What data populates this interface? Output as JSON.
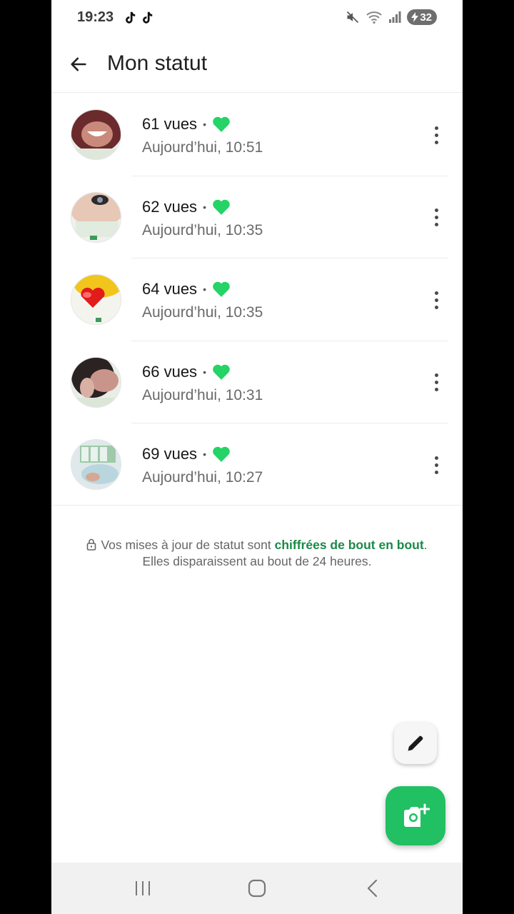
{
  "status_bar": {
    "time": "19:23",
    "battery": "32",
    "icons": [
      "tiktok-icon",
      "tiktok-icon",
      "mute-icon",
      "wifi-icon",
      "signal-icon",
      "battery-charging-icon"
    ]
  },
  "header": {
    "title": "Mon statut",
    "back_icon": "arrow-left-icon"
  },
  "statuses": [
    {
      "views": "61 vues",
      "time": "Aujourd’hui, 10:51",
      "heart_icon": "green-heart-icon"
    },
    {
      "views": "62 vues",
      "time": "Aujourd’hui, 10:35",
      "heart_icon": "green-heart-icon"
    },
    {
      "views": "64 vues",
      "time": "Aujourd’hui, 10:35",
      "heart_icon": "green-heart-icon"
    },
    {
      "views": "66 vues",
      "time": "Aujourd’hui, 10:31",
      "heart_icon": "green-heart-icon"
    },
    {
      "views": "69 vues",
      "time": "Aujourd’hui, 10:27",
      "heart_icon": "green-heart-icon"
    }
  ],
  "notice": {
    "prefix": "Vos mises à jour de statut sont ",
    "link": "chiffrées de bout en bout",
    "suffix": ".",
    "line2": "Elles disparaissent au bout de 24 heures."
  },
  "colors": {
    "accent": "#21c063",
    "link": "#1a8a48",
    "heart": "#25d366"
  },
  "fabs": {
    "edit_icon": "pencil-icon",
    "camera_icon": "camera-add-icon"
  },
  "nav": {
    "icons": [
      "recent-apps-icon",
      "home-icon",
      "back-icon"
    ]
  }
}
